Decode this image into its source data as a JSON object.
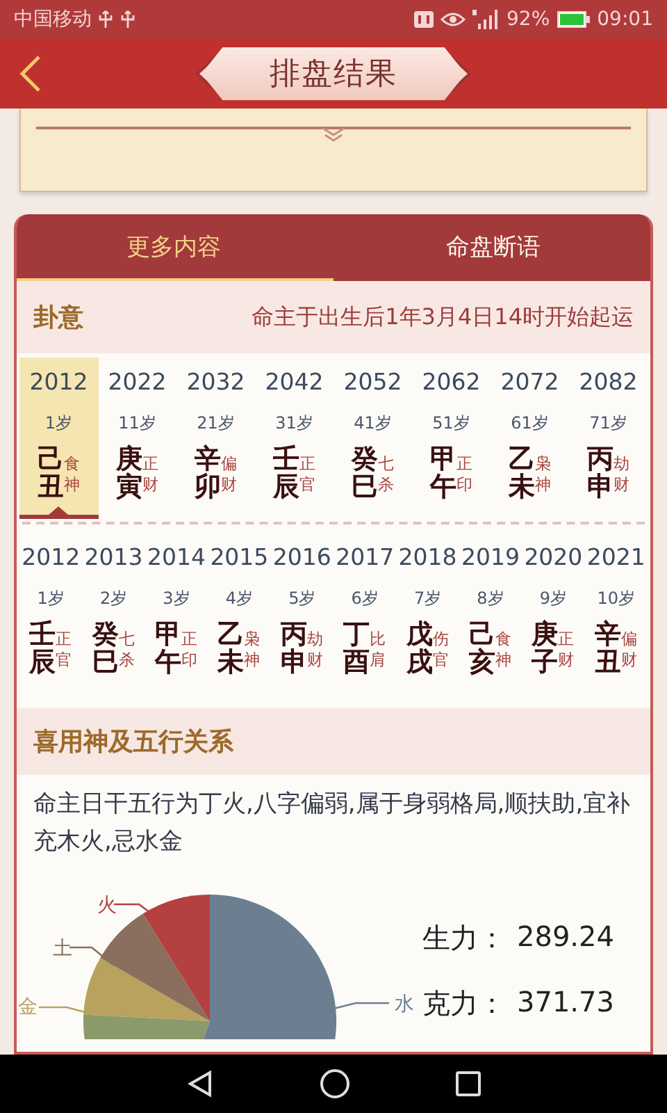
{
  "status_bar": {
    "carrier": "中国移动",
    "battery": "92%",
    "time": "09:01"
  },
  "header": {
    "title": "排盘结果"
  },
  "tabs": [
    {
      "label": "更多内容",
      "selected": true
    },
    {
      "label": "命盘断语",
      "selected": false
    }
  ],
  "fortune": {
    "title": "卦意",
    "note": "命主于出生后1年3月4日14时开始起运"
  },
  "decades": [
    {
      "year": "2012",
      "age": "1岁",
      "stem": "己",
      "branch": "丑",
      "god": [
        "食",
        "神"
      ],
      "selected": true
    },
    {
      "year": "2022",
      "age": "11岁",
      "stem": "庚",
      "branch": "寅",
      "god": [
        "正",
        "财"
      ],
      "selected": false
    },
    {
      "year": "2032",
      "age": "21岁",
      "stem": "辛",
      "branch": "卯",
      "god": [
        "偏",
        "财"
      ],
      "selected": false
    },
    {
      "year": "2042",
      "age": "31岁",
      "stem": "壬",
      "branch": "辰",
      "god": [
        "正",
        "官"
      ],
      "selected": false
    },
    {
      "year": "2052",
      "age": "41岁",
      "stem": "癸",
      "branch": "巳",
      "god": [
        "七",
        "杀"
      ],
      "selected": false
    },
    {
      "year": "2062",
      "age": "51岁",
      "stem": "甲",
      "branch": "午",
      "god": [
        "正",
        "印"
      ],
      "selected": false
    },
    {
      "year": "2072",
      "age": "61岁",
      "stem": "乙",
      "branch": "未",
      "god": [
        "枭",
        "神"
      ],
      "selected": false
    },
    {
      "year": "2082",
      "age": "71岁",
      "stem": "丙",
      "branch": "申",
      "god": [
        "劫",
        "财"
      ],
      "selected": false
    }
  ],
  "years": [
    {
      "year": "2012",
      "age": "1岁",
      "stem": "壬",
      "branch": "辰",
      "god": [
        "正",
        "官"
      ]
    },
    {
      "year": "2013",
      "age": "2岁",
      "stem": "癸",
      "branch": "巳",
      "god": [
        "七",
        "杀"
      ]
    },
    {
      "year": "2014",
      "age": "3岁",
      "stem": "甲",
      "branch": "午",
      "god": [
        "正",
        "印"
      ]
    },
    {
      "year": "2015",
      "age": "4岁",
      "stem": "乙",
      "branch": "未",
      "god": [
        "枭",
        "神"
      ]
    },
    {
      "year": "2016",
      "age": "5岁",
      "stem": "丙",
      "branch": "申",
      "god": [
        "劫",
        "财"
      ]
    },
    {
      "year": "2017",
      "age": "6岁",
      "stem": "丁",
      "branch": "酉",
      "god": [
        "比",
        "肩"
      ]
    },
    {
      "year": "2018",
      "age": "7岁",
      "stem": "戊",
      "branch": "戌",
      "god": [
        "伤",
        "官"
      ]
    },
    {
      "year": "2019",
      "age": "8岁",
      "stem": "己",
      "branch": "亥",
      "god": [
        "食",
        "神"
      ]
    },
    {
      "year": "2020",
      "age": "9岁",
      "stem": "庚",
      "branch": "子",
      "god": [
        "正",
        "财"
      ]
    },
    {
      "year": "2021",
      "age": "10岁",
      "stem": "辛",
      "branch": "丑",
      "god": [
        "偏",
        "财"
      ]
    }
  ],
  "elements": {
    "title": "喜用神及五行关系",
    "text": "命主日干五行为丁火,八字偏弱,属于身弱格局,顺扶助,宜补充木火,忌水金",
    "pie_labels": [
      {
        "label": "火",
        "color": "#b54040"
      },
      {
        "label": "土",
        "color": "#8a6f5e"
      },
      {
        "label": "金",
        "color": "#b9a25e"
      },
      {
        "label": "水",
        "color": "#6b7f91"
      }
    ],
    "stats": [
      {
        "label": "生力：",
        "value": "289.24"
      },
      {
        "label": "克力：",
        "value": "371.73"
      }
    ]
  }
}
